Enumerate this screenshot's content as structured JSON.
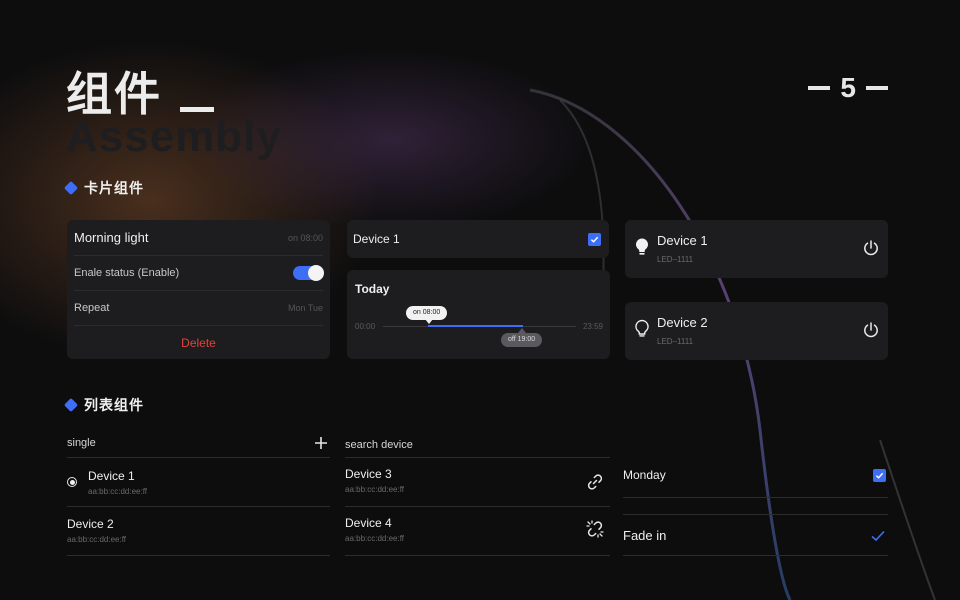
{
  "header": {
    "title": "组件",
    "subtitle": "Assembly",
    "page_number": "5"
  },
  "sections": {
    "cards": "卡片组件",
    "lists": "列表组件"
  },
  "card_settings": {
    "title": "Morning light",
    "title_meta": "on 08:00",
    "status_label": "Enale status (Enable)",
    "status_enabled": true,
    "repeat_label": "Repeat",
    "repeat_value": "Mon  Tue",
    "delete_label": "Delete"
  },
  "card_device_check": {
    "label": "Device 1",
    "checked": true
  },
  "card_timeline": {
    "title": "Today",
    "start": "00:00",
    "end": "23:59",
    "on_tag": "on  08:00",
    "off_tag": "off  19:00"
  },
  "device_cards": [
    {
      "name": "Device 1",
      "model": "LED–1111",
      "icon": "bulb-on-icon"
    },
    {
      "name": "Device 2",
      "model": "LED–1111",
      "icon": "bulb-off-icon"
    }
  ],
  "list_single": {
    "header": "single",
    "items": [
      {
        "name": "Device 1",
        "mac": "aa:bb:cc:dd:ee:ff",
        "selected": true
      },
      {
        "name": "Device 2",
        "mac": "aa:bb:cc:dd:ee:ff"
      }
    ]
  },
  "list_search": {
    "header": "search device",
    "items": [
      {
        "name": "Device 3",
        "mac": "aa:bb:cc:dd:ee:ff",
        "icon": "link-icon"
      },
      {
        "name": "Device 4",
        "mac": "aa:bb:cc:dd:ee:ff",
        "icon": "unlink-icon"
      }
    ]
  },
  "list_options": {
    "items": [
      {
        "label": "Monday",
        "control": "checkbox"
      },
      {
        "label": "Fade in",
        "control": "checkmark"
      }
    ]
  },
  "colors": {
    "accent": "#3d6ef5",
    "danger": "#e0443a",
    "card": "#1d1d1f",
    "background": "#0d0d0e"
  }
}
